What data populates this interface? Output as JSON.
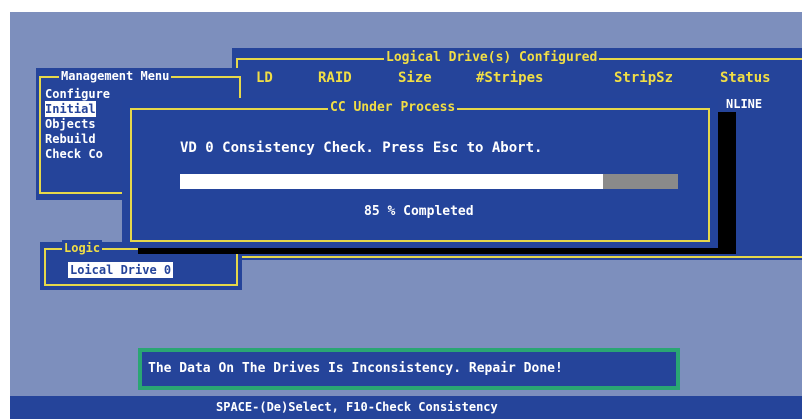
{
  "logical_drives_window": {
    "title": "Logical Drive(s) Configured",
    "columns": [
      "LD",
      "RAID",
      "Size",
      "#Stripes",
      "StripSz",
      "Status"
    ],
    "status_partial": "NLINE"
  },
  "management_menu": {
    "title": "Management Menu",
    "items": [
      "Configure",
      "Initial",
      "Objects",
      "Rebuild",
      "Check Co"
    ],
    "selected_index": 1
  },
  "logical_drive_box": {
    "title": "Logic",
    "item": "Loical Drive 0"
  },
  "cc_dialog": {
    "title": "CC Under Process",
    "message": "VD 0 Consistency Check. Press Esc to Abort.",
    "progress_percent": 85,
    "progress_text": "85 % Completed"
  },
  "notification": {
    "text": "The Data On The Drives Is Inconsistency. Repair Done!"
  },
  "status_bar": {
    "text": "SPACE-(De)Select,  F10-Check Consistency"
  },
  "colors": {
    "background": "#7d8fbd",
    "panel": "#25449a",
    "border_yellow": "#e6d84a",
    "title_yellow": "#f1de45",
    "notification_border": "#2aa673",
    "progress_fill": "#ffffff",
    "progress_track": "#8a8a8a"
  }
}
